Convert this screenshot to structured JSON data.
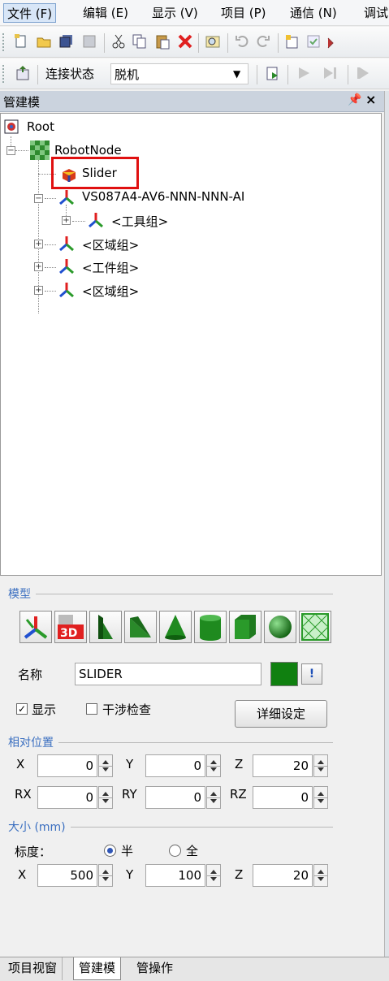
{
  "menubar": {
    "items": [
      "文件 (F)",
      "编辑 (E)",
      "显示 (V)",
      "项目 (P)",
      "通信 (N)",
      "调试"
    ]
  },
  "toolbar2": {
    "status_label": "连接状态",
    "status_value": "脱机"
  },
  "panel": {
    "title": "管建模",
    "pin": "ᵩ",
    "close": "×"
  },
  "tree": {
    "root": "Root",
    "robot_node": "RobotNode",
    "slider": "Slider",
    "robot": "VS087A4-AV6-NNN-NNN-AI",
    "tool_group": "<工具组>",
    "area_group_1": "<区域组>",
    "work_group": "<工件组>",
    "area_group_2": "<区域组>"
  },
  "model": {
    "group_label": "模型",
    "shapes": [
      "axis-tool-icon",
      "3d-model-icon",
      "triangle-prism-icon",
      "wedge-icon",
      "cone-icon",
      "cylinder-icon",
      "cube-icon",
      "sphere-icon",
      "mesh-icon"
    ],
    "name_label": "名称",
    "name_value": "SLIDER",
    "color": "#108010",
    "info_button": "!",
    "show_label": "显示",
    "show_checked": true,
    "interference_label": "干涉检查",
    "interference_checked": false,
    "detail_button": "详细设定"
  },
  "position": {
    "group_label": "相对位置",
    "x_label": "X",
    "x": "0",
    "y_label": "Y",
    "y": "0",
    "z_label": "Z",
    "z": "20",
    "rx_label": "RX",
    "rx": "0",
    "ry_label": "RY",
    "ry": "0",
    "rz_label": "RZ",
    "rz": "0"
  },
  "size": {
    "group_label": "大小 (mm)",
    "scale_label": "标度：",
    "half_label": "半",
    "full_label": "全",
    "half_selected": true,
    "x_label": "X",
    "x": "500",
    "y_label": "Y",
    "y": "100",
    "z_label": "Z",
    "z": "20"
  },
  "tabs": [
    "项目视窗",
    "管建模",
    "管操作"
  ]
}
